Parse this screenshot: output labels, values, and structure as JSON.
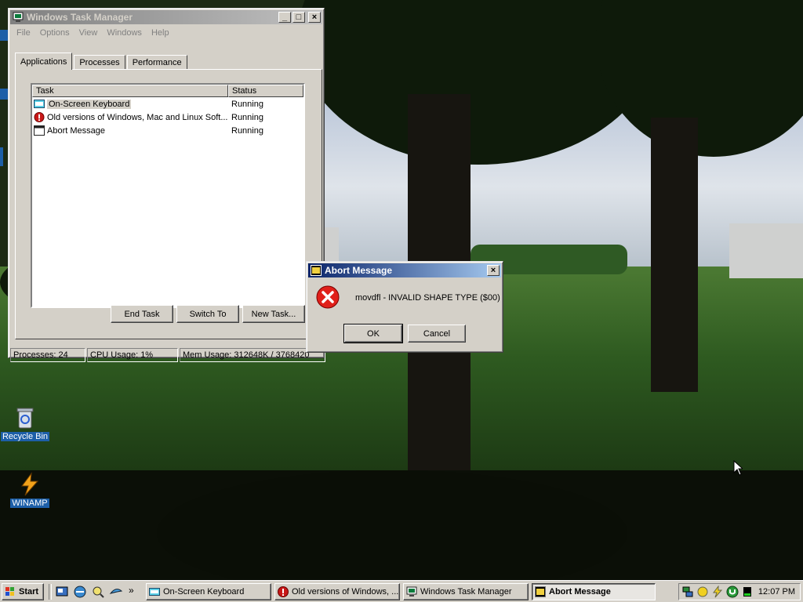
{
  "desktop": {
    "icons": [
      {
        "label": "Recycle Bin",
        "icon": "recycle-bin-icon"
      },
      {
        "label": "WINAMP",
        "icon": "winamp-icon"
      }
    ]
  },
  "task_manager": {
    "title": "Windows Task Manager",
    "menu": [
      "File",
      "Options",
      "View",
      "Windows",
      "Help"
    ],
    "tabs": [
      "Applications",
      "Processes",
      "Performance"
    ],
    "selected_tab": "Applications",
    "columns": [
      "Task",
      "Status"
    ],
    "rows": [
      {
        "task": "On-Screen Keyboard",
        "status": "Running",
        "icon": "keyboard-icon"
      },
      {
        "task": "Old versions of Windows, Mac and Linux Soft...",
        "status": "Running",
        "icon": "error-icon"
      },
      {
        "task": "Abort Message",
        "status": "Running",
        "icon": "window-icon"
      }
    ],
    "buttons": {
      "end_task": "End Task",
      "switch_to": "Switch To",
      "new_task": "New Task..."
    },
    "status": {
      "processes": "Processes: 24",
      "cpu": "CPU Usage: 1%",
      "mem": "Mem Usage: 312648K / 3768420"
    }
  },
  "dialog": {
    "title": "Abort Message",
    "message": "movdfl - INVALID SHAPE TYPE ($00)",
    "ok": "OK",
    "cancel": "Cancel",
    "icon": "error-icon"
  },
  "taskbar": {
    "start": "Start",
    "buttons": [
      {
        "label": "On-Screen Keyboard",
        "icon": "keyboard-icon"
      },
      {
        "label": "Old versions of Windows, ...",
        "icon": "error-icon"
      },
      {
        "label": "Windows Task Manager",
        "icon": "task-manager-icon"
      },
      {
        "label": "Abort Message",
        "icon": "window-icon",
        "active": true
      }
    ],
    "clock": "12:07 PM"
  },
  "colors": {
    "active_title_start": "#0a246a",
    "active_title_end": "#a6caf0",
    "face": "#d4d0c8",
    "error_red": "#e0201a"
  }
}
